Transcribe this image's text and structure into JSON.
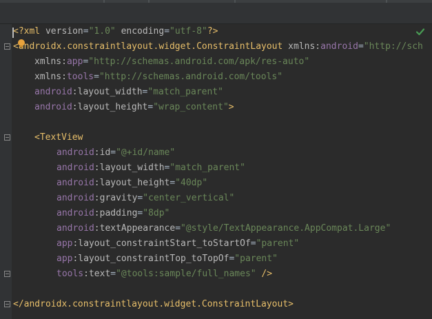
{
  "colors": {
    "background": "#2b2b2b",
    "gutter": "#313335",
    "tag": "#e8bf6a",
    "namespace": "#9876aa",
    "attribute": "#bababa",
    "value": "#6a8759",
    "check": "#499c54",
    "bulb": "#e8a33d"
  },
  "icons": {
    "status": "check-icon",
    "intention": "lightbulb-icon",
    "fold": "fold-icon"
  },
  "editor": {
    "lines": [
      [
        {
          "cls": "tag",
          "text": "<?xml "
        },
        {
          "cls": "attr",
          "text": "version"
        },
        {
          "cls": "plain",
          "text": "="
        },
        {
          "cls": "val",
          "text": "\"1.0\""
        },
        {
          "cls": "plain",
          "text": " "
        },
        {
          "cls": "attr",
          "text": "encoding"
        },
        {
          "cls": "plain",
          "text": "="
        },
        {
          "cls": "val",
          "text": "\"utf-8\""
        },
        {
          "cls": "tag",
          "text": "?>"
        }
      ],
      [
        {
          "cls": "tag",
          "text": "<androidx.constraintlayout.widget.ConstraintLayout "
        },
        {
          "cls": "attr",
          "text": "xmlns:"
        },
        {
          "cls": "ns",
          "text": "android"
        },
        {
          "cls": "plain",
          "text": "="
        },
        {
          "cls": "val",
          "text": "\"http://sch"
        }
      ],
      [
        {
          "cls": "attr",
          "text": "xmlns:"
        },
        {
          "cls": "ns",
          "text": "app"
        },
        {
          "cls": "plain",
          "text": "="
        },
        {
          "cls": "val",
          "text": "\"http://schemas.android.com/apk/res-auto\""
        }
      ],
      [
        {
          "cls": "attr",
          "text": "xmlns:"
        },
        {
          "cls": "ns",
          "text": "tools"
        },
        {
          "cls": "plain",
          "text": "="
        },
        {
          "cls": "val",
          "text": "\"http://schemas.android.com/tools\""
        }
      ],
      [
        {
          "cls": "ns",
          "text": "android"
        },
        {
          "cls": "attr",
          "text": ":layout_width"
        },
        {
          "cls": "plain",
          "text": "="
        },
        {
          "cls": "val",
          "text": "\"match_parent\""
        }
      ],
      [
        {
          "cls": "ns",
          "text": "android"
        },
        {
          "cls": "attr",
          "text": ":layout_height"
        },
        {
          "cls": "plain",
          "text": "="
        },
        {
          "cls": "val",
          "text": "\"wrap_content\""
        },
        {
          "cls": "tag",
          "text": ">"
        }
      ],
      [],
      [
        {
          "cls": "tag",
          "text": "<TextView"
        }
      ],
      [
        {
          "cls": "ns",
          "text": "android"
        },
        {
          "cls": "attr",
          "text": ":id"
        },
        {
          "cls": "plain",
          "text": "="
        },
        {
          "cls": "val",
          "text": "\"@+id/name\""
        }
      ],
      [
        {
          "cls": "ns",
          "text": "android"
        },
        {
          "cls": "attr",
          "text": ":layout_width"
        },
        {
          "cls": "plain",
          "text": "="
        },
        {
          "cls": "val",
          "text": "\"match_parent\""
        }
      ],
      [
        {
          "cls": "ns",
          "text": "android"
        },
        {
          "cls": "attr",
          "text": ":layout_height"
        },
        {
          "cls": "plain",
          "text": "="
        },
        {
          "cls": "val",
          "text": "\"40dp\""
        }
      ],
      [
        {
          "cls": "ns",
          "text": "android"
        },
        {
          "cls": "attr",
          "text": ":gravity"
        },
        {
          "cls": "plain",
          "text": "="
        },
        {
          "cls": "val",
          "text": "\"center_vertical\""
        }
      ],
      [
        {
          "cls": "ns",
          "text": "android"
        },
        {
          "cls": "attr",
          "text": ":padding"
        },
        {
          "cls": "plain",
          "text": "="
        },
        {
          "cls": "val",
          "text": "\"8dp\""
        }
      ],
      [
        {
          "cls": "ns",
          "text": "android"
        },
        {
          "cls": "attr",
          "text": ":textAppearance"
        },
        {
          "cls": "plain",
          "text": "="
        },
        {
          "cls": "val",
          "text": "\"@style/TextAppearance.AppCompat.Large\""
        }
      ],
      [
        {
          "cls": "ns",
          "text": "app"
        },
        {
          "cls": "attr",
          "text": ":layout_constraintStart_toStartOf"
        },
        {
          "cls": "plain",
          "text": "="
        },
        {
          "cls": "val",
          "text": "\"parent\""
        }
      ],
      [
        {
          "cls": "ns",
          "text": "app"
        },
        {
          "cls": "attr",
          "text": ":layout_constraintTop_toTopOf"
        },
        {
          "cls": "plain",
          "text": "="
        },
        {
          "cls": "val",
          "text": "\"parent\""
        }
      ],
      [
        {
          "cls": "ns",
          "text": "tools"
        },
        {
          "cls": "attr",
          "text": ":text"
        },
        {
          "cls": "plain",
          "text": "="
        },
        {
          "cls": "val",
          "text": "\"@tools:sample/full_names\""
        },
        {
          "cls": "tag",
          "text": " />"
        }
      ],
      [],
      [
        {
          "cls": "tag",
          "text": "</androidx.constraintlayout.widget.ConstraintLayout>"
        }
      ]
    ]
  }
}
